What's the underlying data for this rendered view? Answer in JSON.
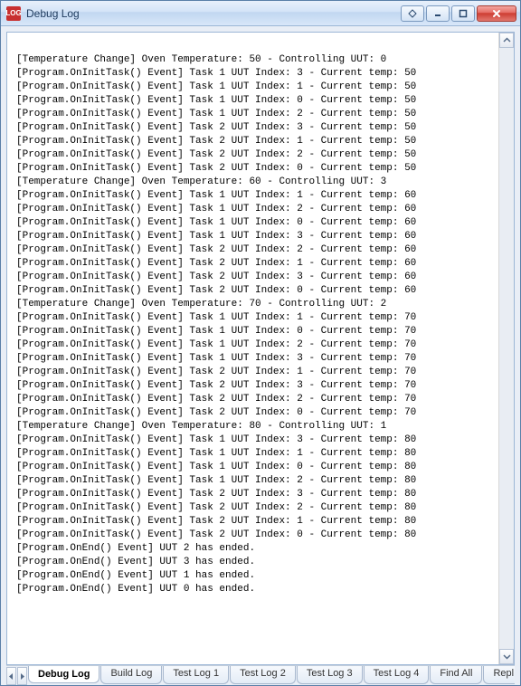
{
  "window": {
    "title": "Debug Log",
    "app_icon_text": "LOG"
  },
  "log_blocks": [
    {
      "header": "[Temperature Change] Oven Temperature: 50 - Controlling UUT: 0",
      "lines": [
        "[Program.OnInitTask() Event] Task 1 UUT Index: 3 - Current temp: 50",
        "[Program.OnInitTask() Event] Task 1 UUT Index: 1 - Current temp: 50",
        "[Program.OnInitTask() Event] Task 1 UUT Index: 0 - Current temp: 50",
        "[Program.OnInitTask() Event] Task 1 UUT Index: 2 - Current temp: 50",
        "[Program.OnInitTask() Event] Task 2 UUT Index: 3 - Current temp: 50",
        "[Program.OnInitTask() Event] Task 2 UUT Index: 1 - Current temp: 50",
        "[Program.OnInitTask() Event] Task 2 UUT Index: 2 - Current temp: 50",
        "[Program.OnInitTask() Event] Task 2 UUT Index: 0 - Current temp: 50"
      ]
    },
    {
      "header": "[Temperature Change] Oven Temperature: 60 - Controlling UUT: 3",
      "lines": [
        "[Program.OnInitTask() Event] Task 1 UUT Index: 1 - Current temp: 60",
        "[Program.OnInitTask() Event] Task 1 UUT Index: 2 - Current temp: 60",
        "[Program.OnInitTask() Event] Task 1 UUT Index: 0 - Current temp: 60",
        "[Program.OnInitTask() Event] Task 1 UUT Index: 3 - Current temp: 60",
        "[Program.OnInitTask() Event] Task 2 UUT Index: 2 - Current temp: 60",
        "[Program.OnInitTask() Event] Task 2 UUT Index: 1 - Current temp: 60",
        "[Program.OnInitTask() Event] Task 2 UUT Index: 3 - Current temp: 60",
        "[Program.OnInitTask() Event] Task 2 UUT Index: 0 - Current temp: 60"
      ]
    },
    {
      "header": "[Temperature Change] Oven Temperature: 70 - Controlling UUT: 2",
      "lines": [
        "[Program.OnInitTask() Event] Task 1 UUT Index: 1 - Current temp: 70",
        "[Program.OnInitTask() Event] Task 1 UUT Index: 0 - Current temp: 70",
        "[Program.OnInitTask() Event] Task 1 UUT Index: 2 - Current temp: 70",
        "[Program.OnInitTask() Event] Task 1 UUT Index: 3 - Current temp: 70",
        "[Program.OnInitTask() Event] Task 2 UUT Index: 1 - Current temp: 70",
        "[Program.OnInitTask() Event] Task 2 UUT Index: 3 - Current temp: 70",
        "[Program.OnInitTask() Event] Task 2 UUT Index: 2 - Current temp: 70",
        "[Program.OnInitTask() Event] Task 2 UUT Index: 0 - Current temp: 70"
      ]
    },
    {
      "header": "[Temperature Change] Oven Temperature: 80 - Controlling UUT: 1",
      "lines": [
        "[Program.OnInitTask() Event] Task 1 UUT Index: 3 - Current temp: 80",
        "[Program.OnInitTask() Event] Task 1 UUT Index: 1 - Current temp: 80",
        "[Program.OnInitTask() Event] Task 1 UUT Index: 0 - Current temp: 80",
        "[Program.OnInitTask() Event] Task 1 UUT Index: 2 - Current temp: 80",
        "[Program.OnInitTask() Event] Task 2 UUT Index: 3 - Current temp: 80",
        "[Program.OnInitTask() Event] Task 2 UUT Index: 2 - Current temp: 80",
        "[Program.OnInitTask() Event] Task 2 UUT Index: 1 - Current temp: 80",
        "[Program.OnInitTask() Event] Task 2 UUT Index: 0 - Current temp: 80",
        "[Program.OnEnd() Event] UUT 2 has ended.",
        "[Program.OnEnd() Event] UUT 3 has ended.",
        "[Program.OnEnd() Event] UUT 1 has ended.",
        "[Program.OnEnd() Event] UUT 0 has ended."
      ]
    }
  ],
  "tabs": {
    "items": [
      {
        "label": "Debug Log",
        "active": true
      },
      {
        "label": "Build Log",
        "active": false
      },
      {
        "label": "Test Log 1",
        "active": false
      },
      {
        "label": "Test Log 2",
        "active": false
      },
      {
        "label": "Test Log 3",
        "active": false
      },
      {
        "label": "Test Log 4",
        "active": false
      },
      {
        "label": "Find All",
        "active": false
      },
      {
        "label": "Repl",
        "active": false
      }
    ]
  }
}
